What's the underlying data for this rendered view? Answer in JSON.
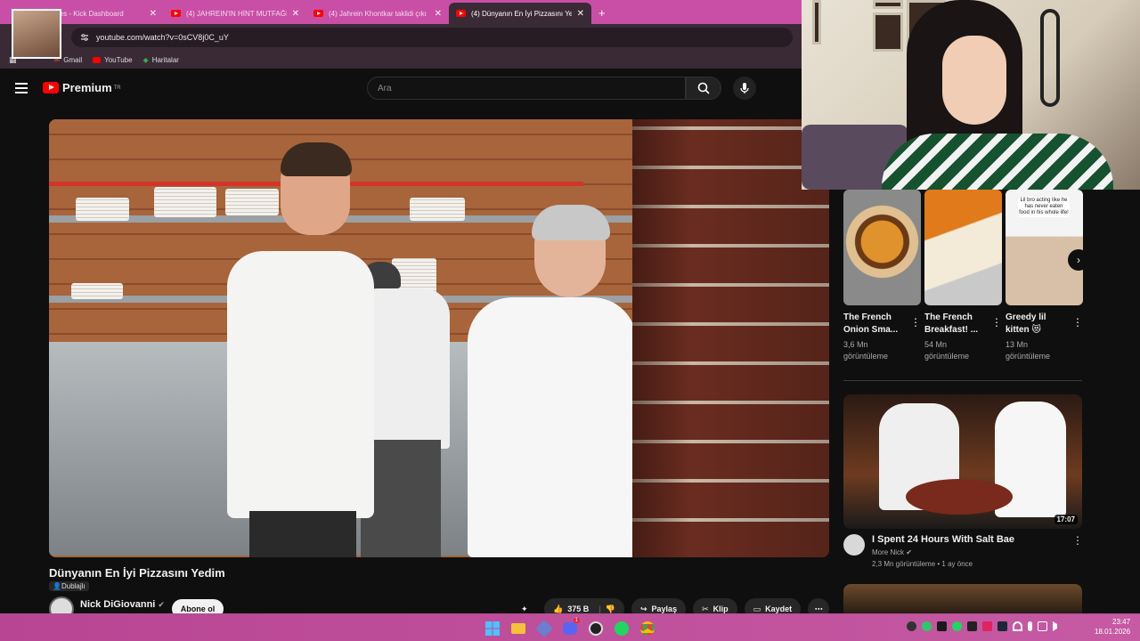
{
  "browser": {
    "tabs": [
      {
        "title": "Badges - Kick Dashboard",
        "icon": "kick-icon"
      },
      {
        "title": "(4) JAHREIN'IN HİNT MUTFAĞI",
        "icon": "youtube-icon"
      },
      {
        "title": "(4) Jahrein Khontkar taklidi çıkı",
        "icon": "youtube-icon"
      },
      {
        "title": "(4) Dünyanın En İyi Pizzasını Yer",
        "icon": "youtube-icon"
      }
    ],
    "url": "youtube.com/watch?v=0sCV8j0C_uY",
    "bookmarks": [
      "Gmail",
      "YouTube",
      "Haritalar"
    ]
  },
  "youtube": {
    "logo_text": "Premium",
    "logo_region": "TR",
    "search_placeholder": "Ara"
  },
  "video": {
    "title": "Dünyanın En İyi Pizzasını Yedim",
    "dub_badge": "Dublajlı",
    "channel": "Nick DiGiovanni",
    "subscribe_label": "Abone ol",
    "likes": "375 B",
    "share_label": "Paylaş",
    "clip_label": "Klip",
    "save_label": "Kaydet"
  },
  "shorts": [
    {
      "title": "The French Onion Sma...",
      "views": "3,6 Mn",
      "views_label": "görüntüleme"
    },
    {
      "title": "The French Breakfast! ...",
      "views": "54 Mn",
      "views_label": "görüntüleme"
    },
    {
      "title": "Greedy lil kitten 😻",
      "views": "13 Mn",
      "views_label": "görüntüleme",
      "caption": "Lil bro acting like he has never eaten food in his whole life!"
    }
  ],
  "recommendation": {
    "title": "I Spent 24 Hours With Salt Bae",
    "channel": "More Nick",
    "meta": "2,3 Mn görüntüleme • 1 ay önce",
    "duration": "17:07"
  },
  "taskbar": {
    "time": "23:47",
    "date": "18.01.2026",
    "discord_badge": "1"
  },
  "colors": {
    "tabbar": "#c94fa6",
    "youtube_red": "#ff0000",
    "background": "#0f0f0f"
  }
}
